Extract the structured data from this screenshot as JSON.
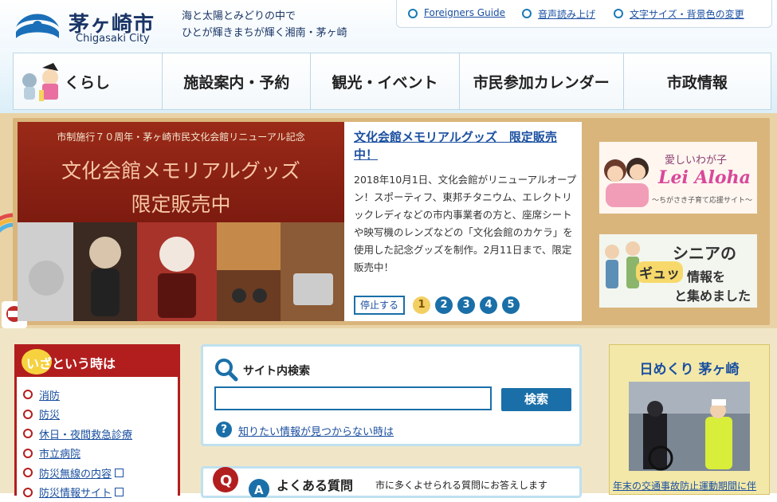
{
  "header": {
    "city_name": "茅ヶ崎市",
    "city_name_en": "Chigasaki City",
    "tagline_1": "海と太陽とみどりの中で",
    "tagline_2": "ひとが輝きまちが輝く湘南・茅ヶ崎",
    "utility_links": [
      "Foreigners Guide",
      "音声読み上げ",
      "文字サイズ・背景色の変更"
    ]
  },
  "nav": {
    "items": [
      "くらし",
      "施設案内・予約",
      "観光・イベント",
      "市民参加カレンダー",
      "市政情報"
    ]
  },
  "slider": {
    "image_caption": "市制施行７０周年・茅ヶ崎市民文化会館リニューアル記念",
    "image_heading_1": "文化会館メモリアルグッズ",
    "image_heading_2": "限定販売中",
    "title": "文化会館メモリアルグッズ　限定販売中！",
    "body": "2018年10月1日、文化会館がリニューアルオープン！スポーティフ、東邦チタニウム、エレクトリックレディなどの市内事業者の方と、座席シートや映写機のレンズなどの「文化会館のカケラ」を使用した記念グッズを制作。2月11日まで、限定販売中！",
    "stop_label": "停止する",
    "pages": [
      "1",
      "2",
      "3",
      "4",
      "5"
    ],
    "active_page": 0
  },
  "ads": {
    "lei_aloha": {
      "line1": "愛しいわが子",
      "line2": "Lei Aloha",
      "line3": "～ちがさき子育て応援サイト～"
    },
    "senior": {
      "line1": "シニアの",
      "line2": "ギュッ",
      "line3": "情報を",
      "line4": "と集めました"
    }
  },
  "emergency": {
    "title": "いざという時は",
    "items": [
      {
        "label": "消防",
        "external": false
      },
      {
        "label": "防災",
        "external": false
      },
      {
        "label": "休日・夜間救急診療",
        "external": false
      },
      {
        "label": "市立病院",
        "external": false
      },
      {
        "label": "防災無線の内容",
        "external": true
      },
      {
        "label": "防災情報サイト",
        "external": true
      }
    ]
  },
  "search": {
    "title": "サイト内検索",
    "input_value": "",
    "button_label": "検索",
    "help_link": "知りたい情報が見つからない時は"
  },
  "faq": {
    "title": "よくある質問",
    "description": "市に多くよせられる質問にお答えします"
  },
  "himekuri": {
    "title": "日めくり 茅ヶ崎",
    "caption": "年末の交通事故防止運動期間に伴"
  },
  "colors": {
    "brand_blue": "#1a4fa0",
    "emergency_red": "#b21e1e",
    "page_yellow": "#f3cf63",
    "band_tan": "#d9b57c"
  }
}
